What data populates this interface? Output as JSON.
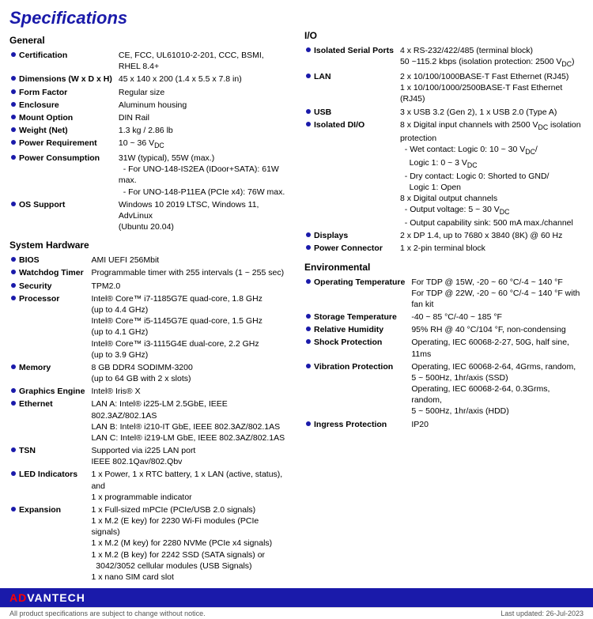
{
  "title": "Specifications",
  "left": {
    "general": {
      "heading": "General",
      "rows": [
        {
          "label": "Certification",
          "value": "CE, FCC, UL61010-2-201, CCC, BSMI, RHEL 8.4+"
        },
        {
          "label": "Dimensions (W x D x H)",
          "value": "45 x 140 x 200 (1.4 x 5.5 x 7.8 in)"
        },
        {
          "label": "Form Factor",
          "value": "Regular size"
        },
        {
          "label": "Enclosure",
          "value": "Aluminum housing"
        },
        {
          "label": "Mount Option",
          "value": "DIN Rail"
        },
        {
          "label": "Weight (Net)",
          "value": "1.3 kg / 2.86 lb"
        },
        {
          "label": "Power Requirement",
          "value": "10 ~ 36 VDC"
        },
        {
          "label": "Power Consumption",
          "value": "31W (typical), 55W (max.)\n- For UNO-148-IS2EA (IDoor+SATA): 61W max.\n- For UNO-148-P11EA (PCIe x4): 76W max."
        }
      ]
    },
    "os_support": {
      "label": "OS Support",
      "value": "Windows 10 2019 LTSC, Windows 11, AdvLinux (Ubuntu 20.04)"
    },
    "system_hardware": {
      "heading": "System Hardware",
      "rows": [
        {
          "label": "BIOS",
          "value": "AMI UEFI 256Mbit"
        },
        {
          "label": "Watchdog Timer",
          "value": "Programmable timer with 255 intervals (1 ~ 255 sec)"
        },
        {
          "label": "Security",
          "value": "TPM2.0"
        },
        {
          "label": "Processor",
          "value": "Intel® Core™ i7-1185G7E quad-core, 1.8 GHz\n(up to 4.4 GHz)\nIntel® Core™ i5-1145G7E quad-core, 1.5 GHz\n(up to 4.1 GHz)\nIntel® Core™ i3-1115G4E dual-core, 2.2 GHz\n(up to 3.9 GHz)"
        },
        {
          "label": "Memory",
          "value": "8 GB DDR4 SODIMM-3200\n(up to 64 GB with 2 x slots)"
        },
        {
          "label": "Graphics Engine",
          "value": "Intel® Iris® X"
        },
        {
          "label": "Ethernet",
          "value": "LAN A: Intel® i225-LM 2.5GbE, IEEE 802.3AZ/802.1AS\nLAN B: Intel® i210-IT GbE, IEEE 802.3AZ/802.1AS\nLAN C: Intel® i219-LM GbE, IEEE 802.3AZ/802.1AS"
        },
        {
          "label": "TSN",
          "value": "Supported via i225 LAN port\nIEEE 802.1Qav/802.Qbv"
        },
        {
          "label": "LED Indicators",
          "value": "1 x Power, 1 x RTC battery, 1 x LAN (active, status), and 1 x programmable indicator"
        },
        {
          "label": "Expansion",
          "value": "1 x Full-sized mPCIe (PCIe/USB 2.0 signals)\n1 x M.2 (E key) for 2230 Wi-Fi modules (PCIe signals)\n1 x M.2 (M key) for 2280 NVMe (PCIe x4 signals)\n1 x M.2 (B key) for 2242 SSD (SATA signals) or 3042/3052 cellular modules (USB Signals)\n1 x nano SIM card slot"
        }
      ]
    }
  },
  "right": {
    "io": {
      "heading": "I/O",
      "rows": [
        {
          "label": "Isolated Serial Ports",
          "value": "4 x RS-232/422/485 (terminal block)\n50 ~115.2 kbps (isolation protection: 2500 VDC)"
        },
        {
          "label": "LAN",
          "value": "2 x 10/100/1000BASE-T Fast Ethernet (RJ45)\n1 x 10/100/1000/2500BASE-T Fast Ethernet (RJ45)"
        },
        {
          "label": "USB",
          "value": "3 x USB 3.2 (Gen 2), 1 x USB 2.0 (Type A)"
        },
        {
          "label": "Isolated DI/O",
          "value": "8 x Digital input channels with 2500 VDC isolation protection\n- Wet contact: Logic 0: 10 ~ 30 VDC/\n  Logic 1: 0 ~ 3 VDC\n- Dry contact: Logic 0: Shorted to GND/\n  Logic 1: Open\n8 x Digital output channels\n- Output voltage: 5 ~ 30 VDC\n- Output capability sink: 500 mA max./channel"
        },
        {
          "label": "Displays",
          "value": "2 x DP 1.4, up to 7680 x 3840 (8K) @ 60 Hz"
        },
        {
          "label": "Power Connector",
          "value": "1 x 2-pin terminal block"
        }
      ]
    },
    "environmental": {
      "heading": "Environmental",
      "rows": [
        {
          "label": "Operating Temperature",
          "value": "For TDP @ 15W, -20 ~ 60 °C/-4 ~ 140 °F\nFor TDP @ 22W, -20 ~ 60 °C/-4 ~ 140 °F with fan kit"
        },
        {
          "label": "Storage Temperature",
          "value": "-40 ~ 85 °C/-40 ~ 185 °F"
        },
        {
          "label": "Relative Humidity",
          "value": "95% RH @ 40 °C/104 °F, non-condensing"
        },
        {
          "label": "Shock Protection",
          "value": "Operating, IEC 60068-2-27, 50G, half sine, 11ms"
        },
        {
          "label": "Vibration Protection",
          "value": "Operating, IEC 60068-2-64, 4Grms, random,\n5 ~ 500Hz, 1hr/axis (SSD)\nOperating, IEC 60068-2-64, 0.3Grms, random,\n5 ~ 500Hz, 1hr/axis (HDD)"
        },
        {
          "label": "Ingress Protection",
          "value": "IP20"
        }
      ]
    }
  },
  "footer": {
    "logo_ad": "AD",
    "logo_vantech": "VANTECH",
    "disclaimer": "All product specifications are subject to change without notice.",
    "last_updated": "Last updated: 26-Jul-2023"
  }
}
